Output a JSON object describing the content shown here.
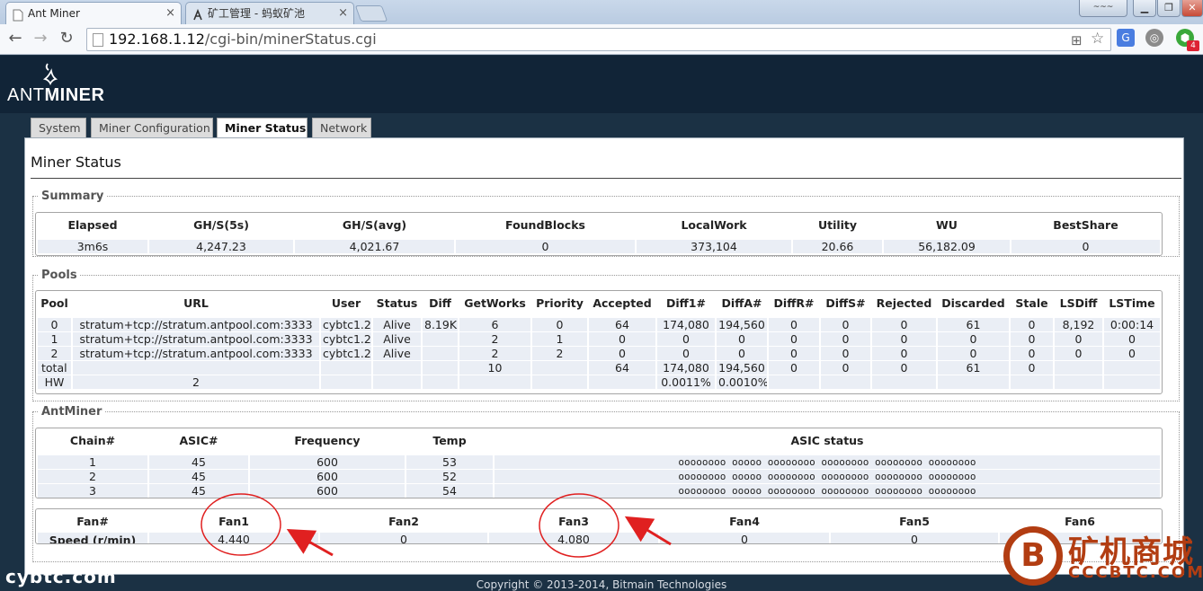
{
  "browser": {
    "tabs": [
      {
        "title": "Ant Miner",
        "active": true
      },
      {
        "title": "矿工管理 - 蚂蚁矿池",
        "active": false
      }
    ],
    "url_host": "192.168.1.12",
    "url_path": "/cgi-bin/minerStatus.cgi",
    "extension_badge": "4"
  },
  "brand": {
    "logo_text_light": "ANT",
    "logo_text_bold": "MINER"
  },
  "nav": {
    "tabs": [
      "System",
      "Miner Configuration",
      "Miner Status",
      "Network"
    ],
    "active": "Miner Status"
  },
  "page": {
    "title": "Miner Status"
  },
  "summary": {
    "legend": "Summary",
    "headers": [
      "Elapsed",
      "GH/S(5s)",
      "GH/S(avg)",
      "FoundBlocks",
      "LocalWork",
      "Utility",
      "WU",
      "BestShare"
    ],
    "row": [
      "3m6s",
      "4,247.23",
      "4,021.67",
      "0",
      "373,104",
      "20.66",
      "56,182.09",
      "0"
    ]
  },
  "pools": {
    "legend": "Pools",
    "headers": [
      "Pool",
      "URL",
      "User",
      "Status",
      "Diff",
      "GetWorks",
      "Priority",
      "Accepted",
      "Diff1#",
      "DiffA#",
      "DiffR#",
      "DiffS#",
      "Rejected",
      "Discarded",
      "Stale",
      "LSDiff",
      "LSTime"
    ],
    "rows": [
      [
        "0",
        "stratum+tcp://stratum.antpool.com:3333",
        "cybtc1.2",
        "Alive",
        "8.19K",
        "6",
        "0",
        "64",
        "174,080",
        "194,560",
        "0",
        "0",
        "0",
        "61",
        "0",
        "8,192",
        "0:00:14"
      ],
      [
        "1",
        "stratum+tcp://stratum.antpool.com:3333",
        "cybtc1.2",
        "Alive",
        "",
        "2",
        "1",
        "0",
        "0",
        "0",
        "0",
        "0",
        "0",
        "0",
        "0",
        "0",
        "0"
      ],
      [
        "2",
        "stratum+tcp://stratum.antpool.com:3333",
        "cybtc1.2",
        "Alive",
        "",
        "2",
        "2",
        "0",
        "0",
        "0",
        "0",
        "0",
        "0",
        "0",
        "0",
        "0",
        "0"
      ],
      [
        "total",
        "",
        "",
        "",
        "",
        "10",
        "",
        "64",
        "174,080",
        "194,560",
        "0",
        "0",
        "0",
        "61",
        "0",
        "",
        ""
      ],
      [
        "HW",
        "2",
        "",
        "",
        "",
        "",
        "",
        "",
        "0.0011%",
        "0.0010%",
        "",
        "",
        "",
        "",
        "",
        "",
        ""
      ]
    ]
  },
  "antminer": {
    "legend": "AntMiner",
    "chain_headers": [
      "Chain#",
      "ASIC#",
      "Frequency",
      "Temp",
      "ASIC status"
    ],
    "chains": [
      [
        "1",
        "45",
        "600",
        "53",
        "oooooooo ooooo oooooooo oooooooo oooooooo oooooooo"
      ],
      [
        "2",
        "45",
        "600",
        "52",
        "oooooooo ooooo oooooooo oooooooo oooooooo oooooooo"
      ],
      [
        "3",
        "45",
        "600",
        "54",
        "oooooooo ooooo oooooooo oooooooo oooooooo oooooooo"
      ]
    ],
    "fan_headers": [
      "Fan#",
      "Fan1",
      "Fan2",
      "Fan3",
      "Fan4",
      "Fan5",
      "Fan6"
    ],
    "fan_row": [
      "Speed (r/min)",
      "4,440",
      "0",
      "4,080",
      "0",
      "0",
      ""
    ]
  },
  "footer": {
    "copyright": "Copyright © 2013-2014, Bitmain Technologies"
  },
  "watermarks": {
    "left": "cybtc.com",
    "right_cn": "矿机商城",
    "right_domain": "CCCBTC.COM",
    "right_coin": "B"
  },
  "colors": {
    "header_bg": "#112437",
    "page_bg": "#1b3144",
    "cell_bg": "#eaeef5",
    "annotation": "#e02020",
    "watermark": "#b23d12"
  }
}
